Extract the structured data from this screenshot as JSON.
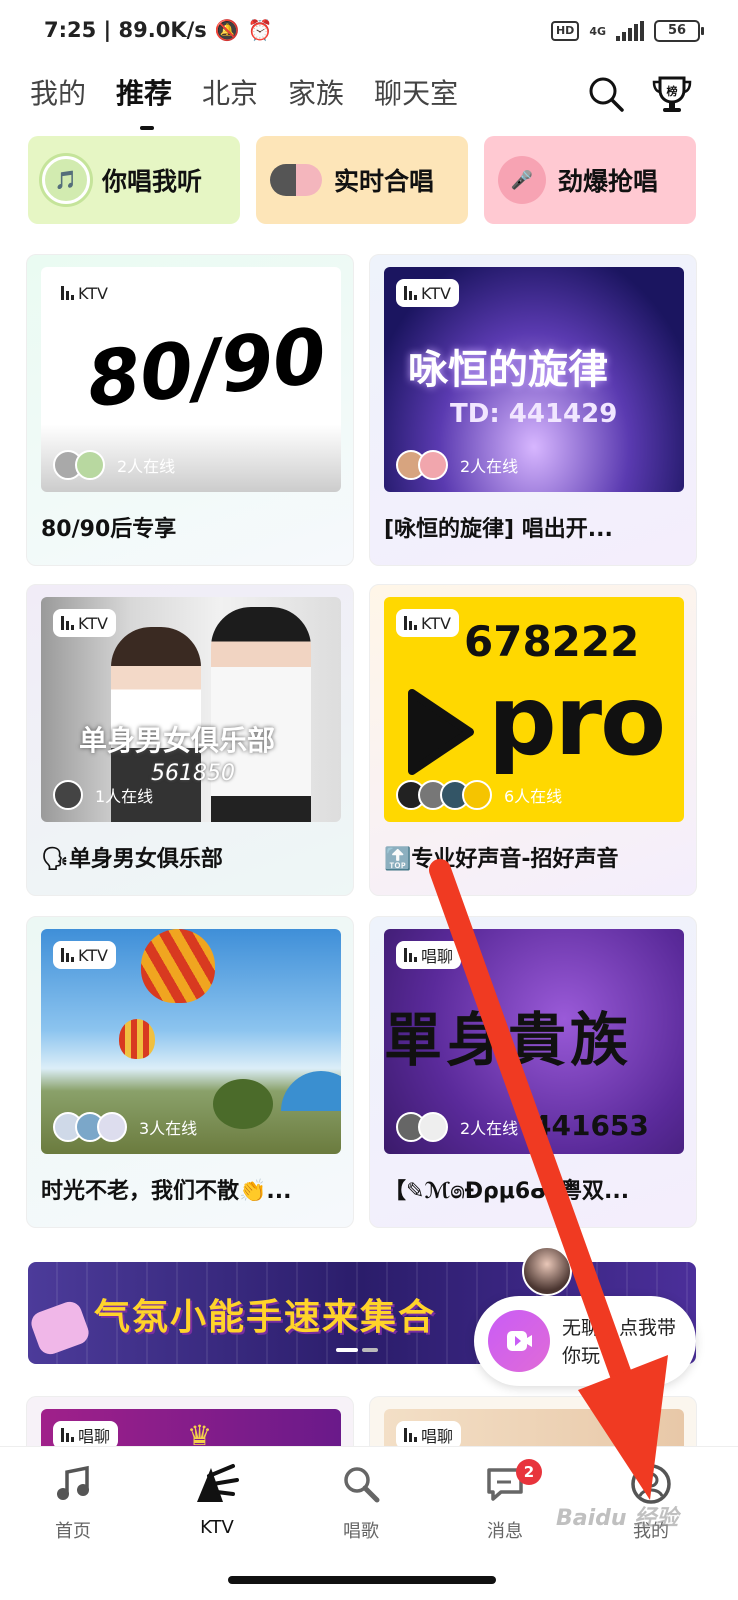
{
  "status": {
    "time_speed": "7:25 | 89.0K/s",
    "hd": "HD",
    "network": "4G",
    "battery": "56"
  },
  "tabs": [
    {
      "label": "我的"
    },
    {
      "label": "推荐"
    },
    {
      "label": "北京"
    },
    {
      "label": "家族"
    },
    {
      "label": "聊天室"
    }
  ],
  "active_tab": "推荐",
  "header_icons": {
    "search": "search-icon",
    "rank": "trophy-icon",
    "rank_text": "榜"
  },
  "quick_buttons": [
    {
      "label": "你唱我听",
      "color": "#e6f6c4"
    },
    {
      "label": "实时合唱",
      "color": "#fde5b8"
    },
    {
      "label": "劲爆抢唱",
      "color": "#ffc9d2"
    }
  ],
  "rooms": [
    {
      "tag": "KTV",
      "online": "2人在线",
      "title": "80/90后专享",
      "image_text": "80/90"
    },
    {
      "tag": "KTV",
      "online": "2人在线",
      "title": "[咏恒的旋律] 唱出开...",
      "image_text": "咏恒的旋律",
      "image_sub": "TD: 441429"
    },
    {
      "tag": "KTV",
      "online": "1人在线",
      "title": "🗣单身男女俱乐部",
      "image_text": "单身男女俱乐部",
      "image_sub": "561850"
    },
    {
      "tag": "KTV",
      "online": "6人在线",
      "title": "🔝专业好声音-招好声音",
      "image_text": "pro",
      "image_sub": "678222"
    },
    {
      "tag": "KTV",
      "online": "3人在线",
      "title": "时光不老，我们不散👏...",
      "image_text": ""
    },
    {
      "tag": "唱聊",
      "online": "2人在线",
      "title": "【✎ℳ෧Ðρμ6ᓂ/粤双...",
      "image_text": "單身貴族",
      "image_sub": "441653"
    }
  ],
  "bottom_row_tags": [
    "唱聊",
    "唱聊"
  ],
  "banner": {
    "text": "气氛小能手速来集合"
  },
  "float_widget": {
    "text": "无聊？点我带你玩"
  },
  "nav": [
    {
      "label": "首页",
      "icon": "music-note-icon"
    },
    {
      "label": "KTV",
      "icon": "ktv-icon"
    },
    {
      "label": "唱歌",
      "icon": "microphone-icon"
    },
    {
      "label": "消息",
      "icon": "message-icon",
      "badge": "2"
    },
    {
      "label": "我的",
      "icon": "profile-icon"
    }
  ],
  "watermark": "Baidu 经验"
}
